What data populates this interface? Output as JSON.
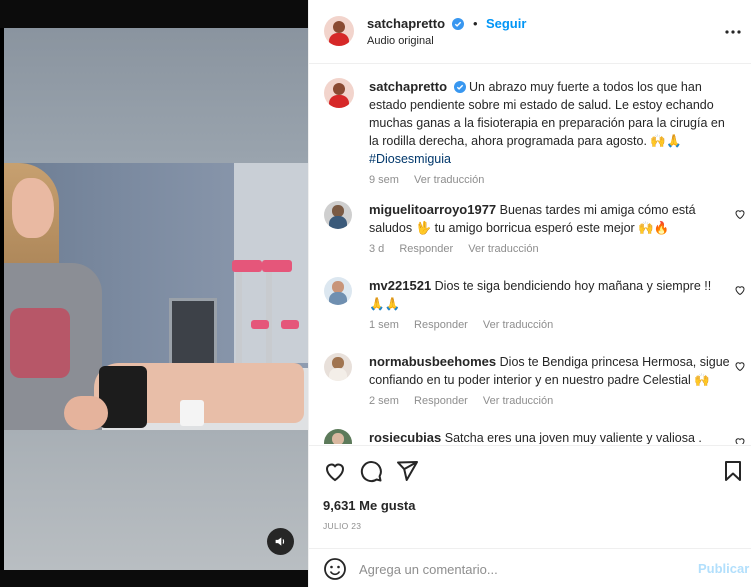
{
  "post": {
    "username": "satchapretto",
    "follow_label": "Seguir",
    "audio": "Audio original",
    "caption_username": "satchapretto",
    "caption_line1": "Un abrazo muy fuerte a todos los que han",
    "caption_line2": "estado pendiente sobre mi estado de salud. Le estoy echando",
    "caption_line3": "muchas ganas a la fisioterapia en preparación para la cirugía en",
    "caption_line4": "la rodilla derecha, ahora programada para agosto. 🙌🙏",
    "caption_hashtag": "#Diosesmiguia",
    "caption_time": "9 sem",
    "caption_translate": "Ver traducción"
  },
  "comments": [
    {
      "username": "miguelitoarroyo1977",
      "text_line1": "Buenas tardes mi amiga cómo está",
      "text_line2": "saludos 🖖 tu amigo borricua esperó este mejor 🙌🔥",
      "time": "3 d",
      "reply": "Responder",
      "translate": "Ver traducción"
    },
    {
      "username": "mv221521",
      "text_line1": "Dios te siga bendiciendo hoy mañana y siempre !!",
      "text_line2": "🙏🙏",
      "time": "1 sem",
      "reply": "Responder",
      "translate": "Ver traducción"
    },
    {
      "username": "normabusbeehomes",
      "text_line1": "Dios te Bendiga princesa Hermosa, sigue",
      "text_line2": "confiando en tu poder interior y en nuestro padre Celestial 🙌",
      "time": "2 sem",
      "reply": "Responder",
      "translate": "Ver traducción"
    },
    {
      "username": "rosiecubias",
      "text_line1": "Satcha eres una joven muy valiente y valiosa ."
    }
  ],
  "stats": {
    "likes": "9,631 Me gusta",
    "date": "JULIO 23"
  },
  "comment_box": {
    "placeholder": "Agrega un comentario...",
    "publish_label": "Publicar"
  },
  "icons": {
    "verified": "verified-badge-icon",
    "more": "more-options-icon",
    "heart": "heart-icon",
    "comment": "comment-icon",
    "share": "share-icon",
    "save": "bookmark-icon",
    "emoji": "emoji-icon",
    "sound": "speaker-icon"
  },
  "colors": {
    "accent": "#0095f6",
    "publish_disabled": "#b2dffc",
    "muted": "#8e8e8e",
    "verified": "#3897f0"
  }
}
